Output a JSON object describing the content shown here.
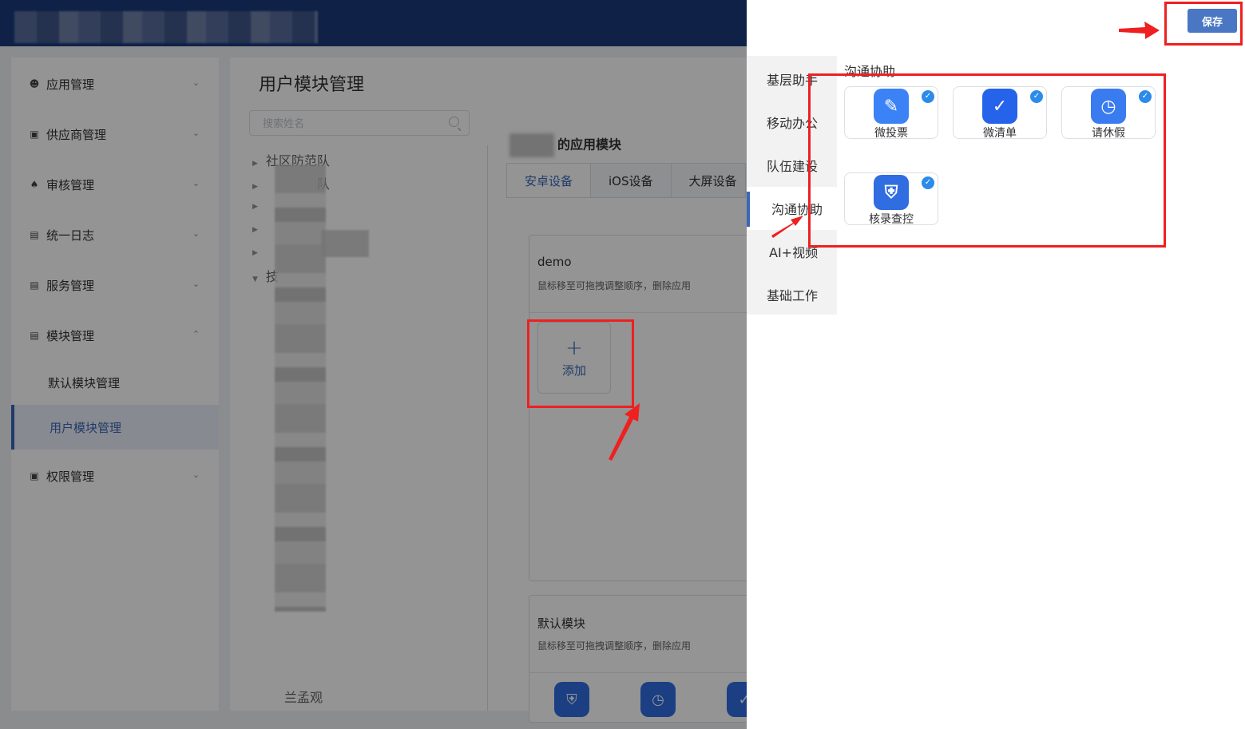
{
  "sidebar": {
    "items": [
      {
        "label": "应用管理",
        "icon": "user-icon"
      },
      {
        "label": "供应商管理",
        "icon": "monitor-icon"
      },
      {
        "label": "审核管理",
        "icon": "stamp-icon"
      },
      {
        "label": "统一日志",
        "icon": "clipboard-icon"
      },
      {
        "label": "服务管理",
        "icon": "clipboard-icon"
      },
      {
        "label": "模块管理",
        "icon": "clipboard-icon"
      },
      {
        "label": "权限管理",
        "icon": "monitor-icon"
      }
    ],
    "subitems": [
      {
        "label": "默认模块管理"
      },
      {
        "label": "用户模块管理"
      }
    ]
  },
  "main": {
    "title": "用户模块管理",
    "search_placeholder": "搜索姓名",
    "tree": [
      "社区防范队",
      "队",
      "",
      "",
      "",
      "技"
    ],
    "tree_footer": "兰孟观",
    "module_title": "的应用模块",
    "tabs": [
      "安卓设备",
      "iOS设备",
      "大屏设备"
    ],
    "cards": [
      {
        "title": "demo",
        "subtitle": "鼠标移至可拖拽调整顺序，删除应用",
        "add_label": "添加",
        "add_symbol": "+"
      },
      {
        "title": "默认模块",
        "subtitle": "鼠标移至可拖拽调整顺序，删除应用"
      }
    ]
  },
  "drawer": {
    "save_label": "保存",
    "categories": [
      "基层助手",
      "移动办公",
      "队伍建设",
      "沟通协助",
      "AI+视频",
      "基础工作"
    ],
    "active_category": "沟通协助",
    "group_title": "沟通协助",
    "apps": [
      {
        "name": "微投票",
        "icon": "vote-icon",
        "color": "#3b82f6",
        "checked": true
      },
      {
        "name": "微清单",
        "icon": "checklist-icon",
        "color": "#2563eb",
        "checked": true
      },
      {
        "name": "请休假",
        "icon": "clock-icon",
        "color": "#3b7bf0",
        "checked": true
      },
      {
        "name": "核录查控",
        "icon": "shield-icon",
        "color": "#2f6de0",
        "checked": true
      }
    ]
  },
  "colors": {
    "header": "#1a3a7a",
    "accent": "#3a67b5",
    "save_button": "#4a77c4",
    "annotation": "#ee2020",
    "check": "#2c8bea"
  }
}
